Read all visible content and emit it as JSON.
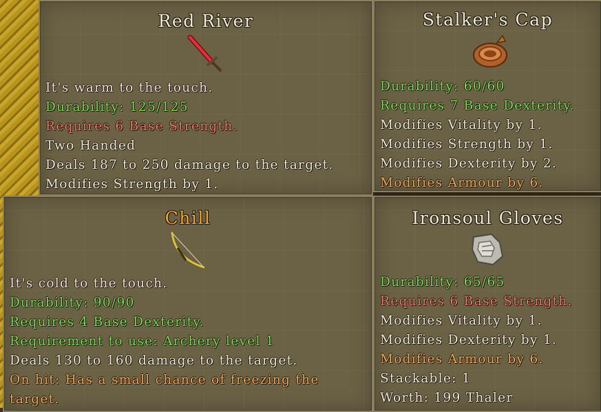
{
  "colors": {
    "flavor": "#f2e3dc",
    "green": "#7fdc5a",
    "red": "#f07a6a",
    "white": "#f0ead8",
    "orange": "#f2a85a",
    "unique_title": "#f2a833"
  },
  "tooltips": {
    "red_river": {
      "title": "Red River",
      "icon": "red-sword-icon",
      "lines": [
        {
          "text": "It's warm to the touch.",
          "color": "flavor"
        },
        {
          "text": "Durability: 125/125",
          "color": "green"
        },
        {
          "text": "Requires 6 Base Strength.",
          "color": "red"
        },
        {
          "text": "Two Handed",
          "color": "white"
        },
        {
          "text": "Deals 187 to 250 damage to the target.",
          "color": "white"
        },
        {
          "text": "Modifies Strength by 1.",
          "color": "white"
        }
      ]
    },
    "stalkers_cap": {
      "title": "Stalker's Cap",
      "icon": "leather-cap-icon",
      "lines": [
        {
          "text": "Durability: 60/60",
          "color": "green"
        },
        {
          "text": "Requires 7 Base Dexterity.",
          "color": "green"
        },
        {
          "text": "Modifies Vitality by 1.",
          "color": "white"
        },
        {
          "text": "Modifies Strength by 1.",
          "color": "white"
        },
        {
          "text": "Modifies Dexterity by 2.",
          "color": "white"
        },
        {
          "text": "Modifies Armour by 6.",
          "color": "orange"
        }
      ]
    },
    "chill": {
      "title": "Chill",
      "icon": "bow-icon",
      "lines": [
        {
          "text": "It's cold to the touch.",
          "color": "flavor"
        },
        {
          "text": "Durability: 90/90",
          "color": "green"
        },
        {
          "text": "Requires 4 Base Dexterity.",
          "color": "green"
        },
        {
          "text": "Requirement to use: Archery level 1",
          "color": "green"
        },
        {
          "text": "Deals 130 to 160 damage to the target.",
          "color": "white"
        },
        {
          "text": "On hit: Has a small chance of freezing the",
          "color": "orange"
        },
        {
          "text": "target.",
          "color": "orange"
        }
      ]
    },
    "ironsoul_gloves": {
      "title": "Ironsoul Gloves",
      "icon": "gauntlet-icon",
      "lines": [
        {
          "text": "Durability: 65/65",
          "color": "green"
        },
        {
          "text": "Requires 6 Base Strength.",
          "color": "red"
        },
        {
          "text": "Modifies Vitality by 1.",
          "color": "white"
        },
        {
          "text": "Modifies Dexterity by 1.",
          "color": "white"
        },
        {
          "text": "Modifies Armour by 6.",
          "color": "orange"
        },
        {
          "text": "Stackable: 1",
          "color": "white"
        },
        {
          "text": "Worth: 199 Thaler",
          "color": "white"
        }
      ]
    }
  }
}
